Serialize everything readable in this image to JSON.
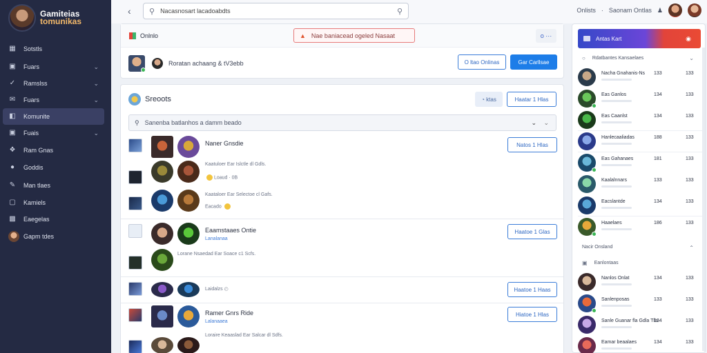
{
  "colors": {
    "sidebar_bg": "#242a43",
    "accent_blue": "#1d7de8",
    "alert_red": "#e67a7a",
    "online_green": "#3ab554"
  },
  "brand": {
    "line1": "Gamiteias",
    "line2": "tomunikas"
  },
  "sidebar": {
    "items": [
      {
        "label": "Sotstls",
        "icon": "dashboard-icon",
        "active": false,
        "chevron": false
      },
      {
        "label": "Fuars",
        "icon": "calendar-icon",
        "active": false,
        "chevron": true
      },
      {
        "label": "Ramslss",
        "icon": "checkmark-icon",
        "active": false,
        "chevron": true
      },
      {
        "label": "Fuars",
        "icon": "mail-icon",
        "active": false,
        "chevron": true
      },
      {
        "label": "Komunite",
        "icon": "card-icon",
        "active": true,
        "chevron": false
      },
      {
        "label": "Fuais",
        "icon": "calendar-icon",
        "active": false,
        "chevron": true
      },
      {
        "label": "Ram Gnas",
        "icon": "puzzle-icon",
        "active": false,
        "chevron": false
      },
      {
        "label": "Goddis",
        "icon": "bubble-icon",
        "active": false,
        "chevron": false
      },
      {
        "label": "Man tlaes",
        "icon": "pencil-icon",
        "active": false,
        "chevron": false
      },
      {
        "label": "Kamiels",
        "icon": "window-icon",
        "active": false,
        "chevron": false
      },
      {
        "label": "Eaegelas",
        "icon": "monitor-icon",
        "active": false,
        "chevron": false
      },
      {
        "label": "Gapm tdes",
        "icon": "user-avatar",
        "active": false,
        "chevron": false
      }
    ]
  },
  "topbar": {
    "search_value": "Nacasnosart lacadoabdts",
    "right_text_1": "Onlists",
    "right_text_2": "Saonam Ontlas"
  },
  "status_panel": {
    "label": "Onlnlo",
    "alert": "Nae baniacead ogeled Nasaat",
    "gear_label": "o ···",
    "me_text": "Roratan achaang  & tV3ebb",
    "btn_outline": "O ltao Onlinas",
    "btn_solid": "Gar Carllsae"
  },
  "friends": {
    "title": "Sreoots",
    "small_btn": "◔ ktas",
    "top_btn": "Haatar 1 Hlas",
    "filter_text": "Sanenba batlanhos a damm beado",
    "groups": [
      {
        "title": "Naner Gnsdie",
        "lines": [
          "Kaatuloer  Ear Islctle  dl Gdls.",
          "Loaud  ·  0B",
          "Kaataloer  Ear Selectoe  cl Gafs.",
          "Eacado"
        ],
        "btn": "Natos 1 Hlas"
      },
      {
        "title": "Eaamstaaes Ontie",
        "lines": [
          "Lanalanaa",
          "Lorane Nsaedad  Ear Soace  c1 Scfs."
        ],
        "btn": "Haatoe 1 Glas"
      },
      {
        "title": "",
        "lines": [
          "Laidalzs"
        ],
        "btn": "Haatoe 1 Haas"
      },
      {
        "title": "Ramer Gnrs Ride",
        "lines": [
          "Lalanaaea",
          "Loraire Keaaslad  Ear Salcar  dl Sdfs."
        ],
        "btn": "Hiatoe 1 Hlas"
      }
    ]
  },
  "right_panel": {
    "header": "Antas Kart",
    "section1": "Rdatbantes Kansaelaes",
    "rows1": [
      {
        "name": "Nacha Gnahanis-Ns",
        "n1": "133",
        "n2": "133"
      },
      {
        "name": "Eas Ganlos",
        "n1": "134",
        "n2": "133"
      },
      {
        "name": "Eas Caanlst",
        "n1": "134",
        "n2": "133"
      },
      {
        "name": "Hanlecaaliadas",
        "n1": "188",
        "n2": "133"
      },
      {
        "name": "Eas Gahanaes",
        "n1": "181",
        "n2": "133"
      },
      {
        "name": "Kaalalnnars",
        "n1": "133",
        "n2": "133"
      },
      {
        "name": "Eacslantde",
        "n1": "134",
        "n2": "133"
      },
      {
        "name": "Haaelaes",
        "n1": "186",
        "n2": "133"
      }
    ],
    "section2": "Nacir Onsland",
    "section3": "Eanlontaas",
    "rows2": [
      {
        "name": "Nanlos Onlat",
        "n1": "134",
        "n2": "133"
      },
      {
        "name": "Sanlenposas",
        "n1": "133",
        "n2": "133"
      },
      {
        "name": "Sanle  Guanar fla Gdla Tlls",
        "n1": "134",
        "n2": "133"
      },
      {
        "name": "Eamar beaalaes",
        "n1": "134",
        "n2": "133"
      }
    ]
  }
}
